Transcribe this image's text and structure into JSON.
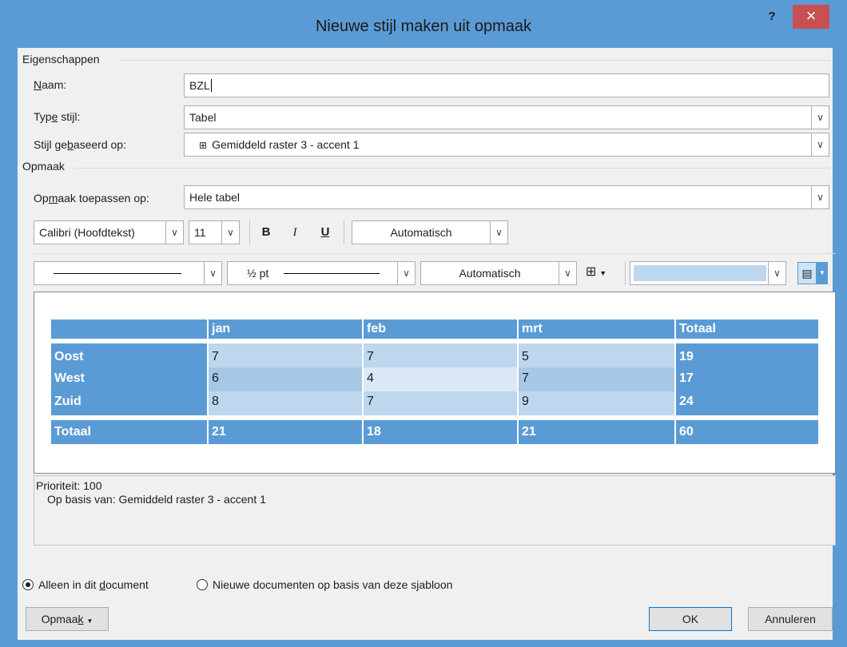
{
  "dialog": {
    "title": "Nieuwe stijl maken uit opmaak",
    "help_label": "?",
    "close_label": "×"
  },
  "properties": {
    "group_label": "Eigenschappen",
    "name_label_u": "N",
    "name_label_rest": "aam:",
    "name_value": "BZL",
    "type_label_pre": "Typ",
    "type_label_u": "e",
    "type_label_post": " stijl:",
    "type_value": "Tabel",
    "based_label_pre": "Stijl ge",
    "based_label_u": "b",
    "based_label_post": "aseerd op:",
    "based_value": "Gemiddeld raster 3 - accent 1"
  },
  "format": {
    "group_label": "Opmaak",
    "apply_label_pre": "Op",
    "apply_label_u": "m",
    "apply_label_post": "aak toepassen op:",
    "apply_value": "Hele tabel",
    "font_value": "Calibri (Hoofdtekst)",
    "size_value": "11",
    "bold_label": "B",
    "italic_label": "I",
    "underline_label": "U",
    "font_color_value": "Automatisch",
    "line_weight_value": "½ pt",
    "border_color_value": "Automatisch"
  },
  "preview_table": {
    "headers": [
      "",
      "jan",
      "feb",
      "mrt",
      "Totaal"
    ],
    "rows": [
      [
        "Oost",
        "7",
        "7",
        "5",
        "19"
      ],
      [
        "West",
        "6",
        "4",
        "7",
        "17"
      ],
      [
        "Zuid",
        "8",
        "7",
        "9",
        "24"
      ]
    ],
    "total_row": [
      "Totaal",
      "21",
      "18",
      "21",
      "60"
    ]
  },
  "description": {
    "line1": "Prioriteit: 100",
    "line2": "Op basis van: Gemiddeld raster 3 - accent 1"
  },
  "scope": {
    "option1_pre": "Alleen in dit ",
    "option1_u": "d",
    "option1_post": "ocument",
    "option1_checked": true,
    "option2": "Nieuwe documenten op basis van deze sjabloon"
  },
  "buttons": {
    "format_pre": "Opmaa",
    "format_u": "k",
    "ok": "OK",
    "cancel": "Annuleren"
  },
  "colors": {
    "accent": "#5b9bd5",
    "band_light": "#bdd7ee",
    "band_mid": "#a7c7e7",
    "band_selected": "#dbe9f6"
  }
}
